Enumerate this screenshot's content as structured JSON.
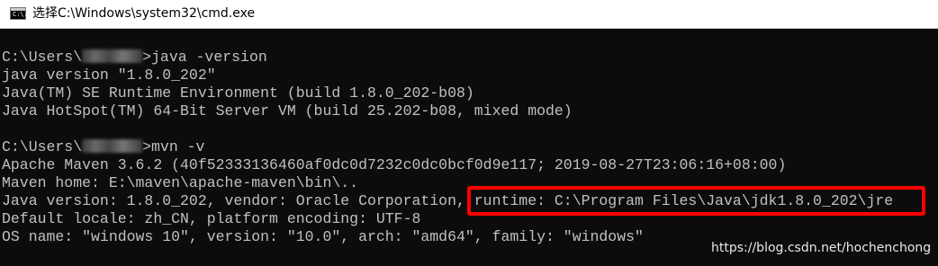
{
  "window": {
    "title": "选择C:\\Windows\\system32\\cmd.exe",
    "icon": "cmd-icon",
    "icon_text": "C:\\."
  },
  "console": {
    "lines": [
      "",
      "C:\\Users\\",
      "java version \"1.8.0_202\"",
      "Java(TM) SE Runtime Environment (build 1.8.0_202-b08)",
      "Java HotSpot(TM) 64-Bit Server VM (build 25.202-b08, mixed mode)",
      "",
      "C:\\Users\\",
      "Apache Maven 3.6.2 (40f52333136460af0dc0d7232c0dc0bcf0d9e117; 2019-08-27T23:06:16+08:00)",
      "Maven home: E:\\maven\\apache-maven\\bin\\..",
      "Java version: 1.8.0_202, vendor: Oracle Corporation, runtime: C:\\Program Files\\Java\\jdk1.8.0_202\\jre",
      "Default locale: zh_CN, platform encoding: UTF-8",
      "OS name: \"windows 10\", version: \"10.0\", arch: \"amd64\", family: \"windows\""
    ],
    "prompt_suffix_1": ">java -version",
    "prompt_suffix_2": ">mvn -v"
  },
  "annotation": {
    "highlight_color": "#ff0000",
    "highlighted_text": "runtime: C:\\Program Files\\Java\\jdk1.8.0_202\\jre"
  },
  "watermark": "https://blog.csdn.net/hochenchong",
  "colors": {
    "console_background": "#0c0c0c",
    "console_text": "#c0c0c0",
    "titlebar_background": "#ffffff"
  }
}
